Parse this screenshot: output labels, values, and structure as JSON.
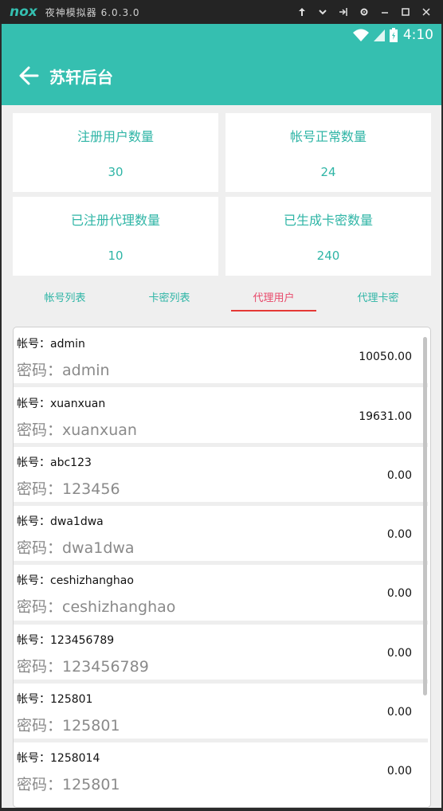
{
  "emulator": {
    "logo": "nox",
    "title": "夜神模拟器 6.0.3.0",
    "controls": [
      "pin-icon",
      "chevron-down-icon",
      "undock-icon",
      "gear-icon",
      "minimize-icon",
      "maximize-icon",
      "close-icon"
    ]
  },
  "status_bar": {
    "time": "4:10"
  },
  "app_bar": {
    "title": "苏轩后台"
  },
  "stats": [
    {
      "label": "注册用户数量",
      "value": "30"
    },
    {
      "label": "帐号正常数量",
      "value": "24"
    },
    {
      "label": "已注册代理数量",
      "value": "10"
    },
    {
      "label": "已生成卡密数量",
      "value": "240"
    }
  ],
  "tabs": [
    {
      "label": "帐号列表",
      "active": false
    },
    {
      "label": "卡密列表",
      "active": false
    },
    {
      "label": "代理用户",
      "active": true
    },
    {
      "label": "代理卡密",
      "active": false
    }
  ],
  "rows": [
    {
      "account": "帐号：admin",
      "password": "密码：admin",
      "amount": "10050.00"
    },
    {
      "account": "帐号：xuanxuan",
      "password": "密码：xuanxuan",
      "amount": "19631.00"
    },
    {
      "account": "帐号：abc123",
      "password": "密码：123456",
      "amount": "0.00"
    },
    {
      "account": "帐号：dwa1dwa",
      "password": "密码：dwa1dwa",
      "amount": "0.00"
    },
    {
      "account": "帐号：ceshizhanghao",
      "password": "密码：ceshizhanghao",
      "amount": "0.00"
    },
    {
      "account": "帐号：123456789",
      "password": "密码：123456789",
      "amount": "0.00"
    },
    {
      "account": "帐号：125801",
      "password": "密码：125801",
      "amount": "0.00"
    },
    {
      "account": "帐号：1258014",
      "password": "密码：125801",
      "amount": "0.00"
    }
  ],
  "colors": {
    "primary": "#35bfb0",
    "accent": "#e8496a",
    "underline": "#e53935"
  }
}
